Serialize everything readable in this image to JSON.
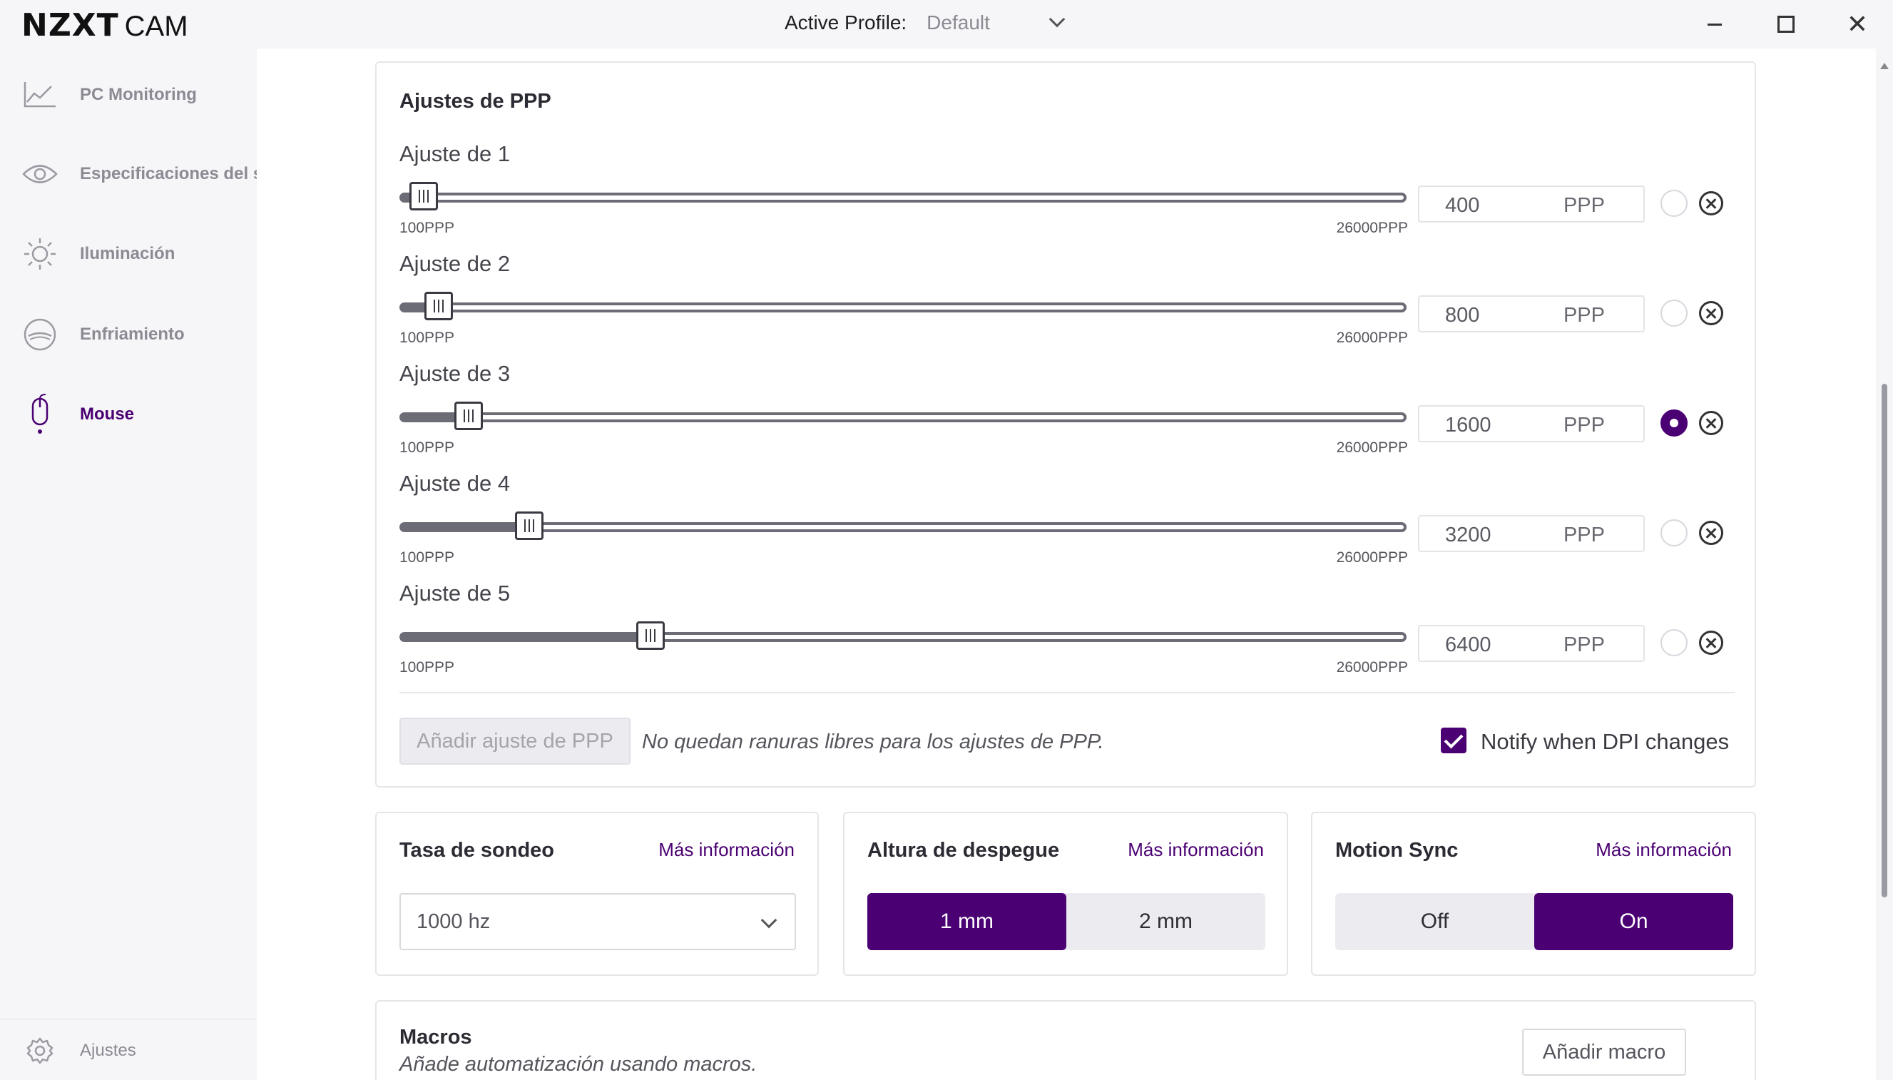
{
  "titlebar": {
    "logo_main": "NZXT",
    "logo_sub": "CAM",
    "profile_label": "Active Profile:",
    "profile_value": "Default"
  },
  "sidebar": {
    "items": [
      {
        "label": "PC Monitoring",
        "icon": "chart-line-icon",
        "active": false
      },
      {
        "label": "Especificaciones del sis",
        "icon": "eye-icon",
        "active": false
      },
      {
        "label": "Iluminación",
        "icon": "sun-icon",
        "active": false
      },
      {
        "label": "Enfriamiento",
        "icon": "fan-icon",
        "active": false
      },
      {
        "label": "Mouse",
        "icon": "mouse-icon",
        "active": true
      }
    ],
    "settings_label": "Ajustes"
  },
  "dpi": {
    "title": "Ajustes de PPP",
    "min": 100,
    "max": 26000,
    "min_label": "100PPP",
    "max_label": "26000PPP",
    "unit": "PPP",
    "levels": [
      {
        "label": "Ajuste de 1",
        "value": "400",
        "selected": false
      },
      {
        "label": "Ajuste de 2",
        "value": "800",
        "selected": false
      },
      {
        "label": "Ajuste de 3",
        "value": "1600",
        "selected": true
      },
      {
        "label": "Ajuste de 4",
        "value": "3200",
        "selected": false
      },
      {
        "label": "Ajuste de 5",
        "value": "6400",
        "selected": false
      }
    ],
    "add_button": "Añadir ajuste de PPP",
    "no_slots_text": "No quedan ranuras libres para los ajustes de PPP.",
    "notify_label": "Notify when DPI changes",
    "notify_checked": true
  },
  "polling": {
    "title": "Tasa de sondeo",
    "more_info": "Más información",
    "value": "1000 hz"
  },
  "liftoff": {
    "title": "Altura de despegue",
    "more_info": "Más información",
    "options": [
      "1 mm",
      "2 mm"
    ],
    "selected": 0
  },
  "motion_sync": {
    "title": "Motion Sync",
    "more_info": "Más información",
    "options": [
      "Off",
      "On"
    ],
    "selected": 1
  },
  "macros": {
    "title": "Macros",
    "subtitle": "Añade automatización usando macros.",
    "add_button": "Añadir macro"
  },
  "colors": {
    "accent": "#4a0072",
    "track": "#6c6c76",
    "sidebar_bg": "#f6f6f8"
  }
}
